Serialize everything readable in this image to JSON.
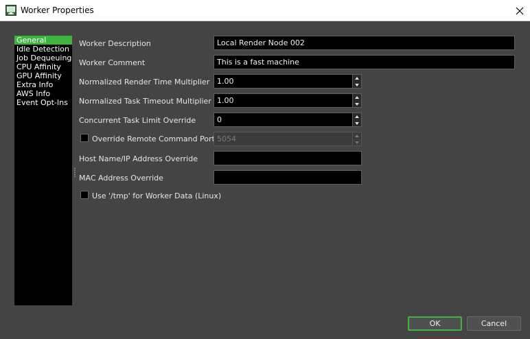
{
  "window": {
    "title": "Worker Properties",
    "icon": "monitor-app-icon"
  },
  "sidebar": {
    "items": [
      {
        "label": "General",
        "selected": true
      },
      {
        "label": "Idle Detection"
      },
      {
        "label": "Job Dequeuing"
      },
      {
        "label": "CPU Affinity"
      },
      {
        "label": "GPU Affinity"
      },
      {
        "label": "Extra Info"
      },
      {
        "label": "AWS Info"
      },
      {
        "label": "Event Opt-Ins"
      }
    ]
  },
  "form": {
    "worker_description": {
      "label": "Worker Description",
      "value": "Local Render Node 002"
    },
    "worker_comment": {
      "label": "Worker Comment",
      "value": "This is a fast machine"
    },
    "render_time_multiplier": {
      "label": "Normalized Render Time Multiplier",
      "value": "1.00"
    },
    "task_timeout_multiplier": {
      "label": "Normalized Task Timeout Multiplier",
      "value": "1.00"
    },
    "task_limit_override": {
      "label": "Concurrent Task Limit Override",
      "value": "0"
    },
    "override_remote_port": {
      "label": "Override Remote Command Port",
      "checked": false,
      "value": "5054",
      "enabled": false
    },
    "host_override": {
      "label": "Host Name/IP Address Override",
      "value": ""
    },
    "mac_override": {
      "label": "MAC Address Override",
      "value": ""
    },
    "use_tmp": {
      "label": "Use '/tmp' for Worker Data (Linux)",
      "checked": false
    }
  },
  "buttons": {
    "ok": "OK",
    "cancel": "Cancel"
  },
  "colors": {
    "accent": "#3fb43f",
    "background": "#444444",
    "field": "#000000"
  }
}
